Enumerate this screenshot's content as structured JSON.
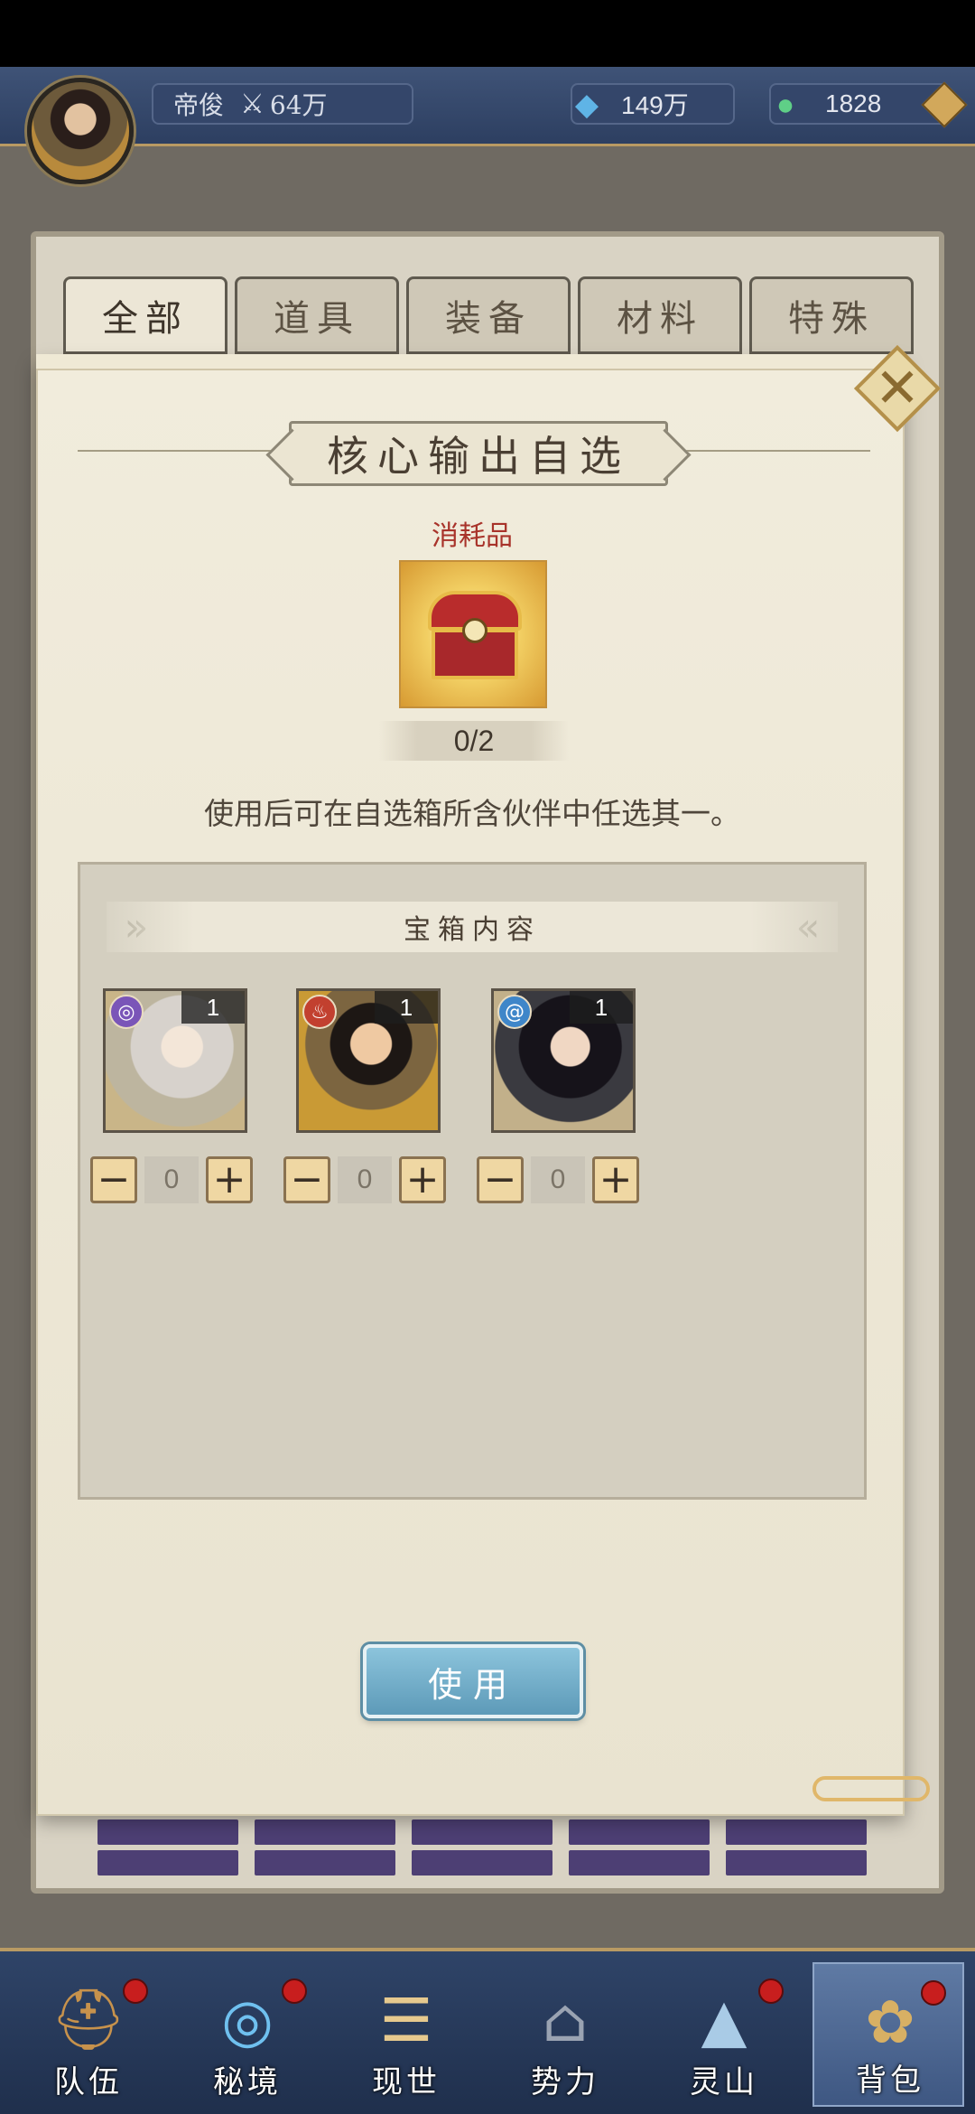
{
  "player": {
    "name": "帝俊",
    "power": "64万"
  },
  "resources": {
    "crystal": "149万",
    "jade": "1828"
  },
  "tabs": [
    "全部",
    "道具",
    "装备",
    "材料",
    "特殊"
  ],
  "modal": {
    "title": "核心输出自选",
    "category": "消耗品",
    "count": "0/2",
    "description": "使用后可在自选箱所含伙伴中任选其一。",
    "contents_title": "宝箱内容",
    "use_label": "使用",
    "partners": [
      {
        "icon": "purple-element-icon",
        "quantity": "1",
        "selected": "0"
      },
      {
        "icon": "fire-element-icon",
        "quantity": "1",
        "selected": "0"
      },
      {
        "icon": "water-element-icon",
        "quantity": "1",
        "selected": "0"
      }
    ]
  },
  "nav": [
    {
      "label": "队伍",
      "icon": "team-icon",
      "badge": true
    },
    {
      "label": "秘境",
      "icon": "secret-realm-icon",
      "badge": true
    },
    {
      "label": "现世",
      "icon": "world-icon",
      "badge": false
    },
    {
      "label": "势力",
      "icon": "faction-icon",
      "badge": false
    },
    {
      "label": "灵山",
      "icon": "mountain-icon",
      "badge": true
    },
    {
      "label": "背包",
      "icon": "backpack-icon",
      "badge": true,
      "active": true
    }
  ],
  "colors": {
    "accent_red": "#a8332a",
    "use_button": "#5d9ab8",
    "nav_bg": "#2f4468"
  }
}
